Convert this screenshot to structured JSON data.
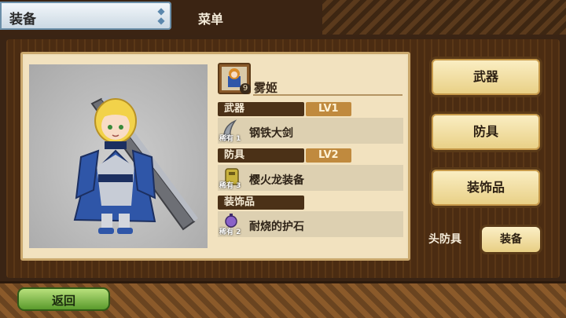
{
  "header": {
    "title": "装备",
    "menu_label": "菜单"
  },
  "character": {
    "name": "雾姬",
    "level_badge": "9"
  },
  "sections": {
    "weapon": {
      "label": "武器",
      "level": "LV1",
      "item_name": "钢铁大剑",
      "rarity": "稀有 1"
    },
    "armor": {
      "label": "防具",
      "level": "LV2",
      "item_name": "樱火龙装备",
      "rarity": "稀有 3"
    },
    "accessory": {
      "label": "装饰品",
      "item_name": "耐烧的护石",
      "rarity": "稀有 2"
    }
  },
  "side_buttons": {
    "weapon": "武器",
    "armor": "防具",
    "accessory": "装饰品"
  },
  "head_armor": {
    "label": "头防具",
    "button": "装备"
  },
  "footer": {
    "back_label": "返回"
  },
  "colors": {
    "armor_blue": "#2f56a8",
    "hair_yellow": "#f2d24a",
    "back_green": "#7bb83e"
  }
}
